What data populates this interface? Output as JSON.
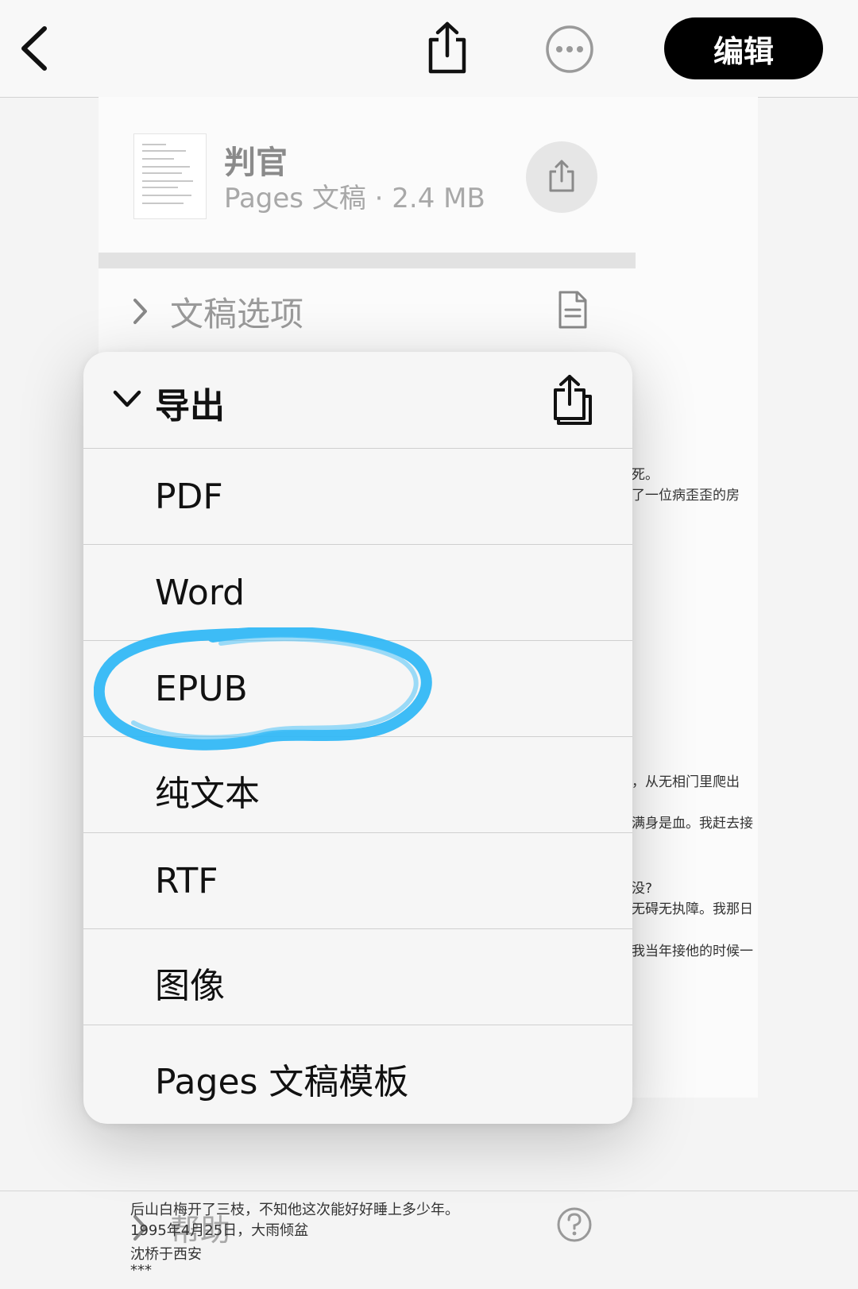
{
  "toolbar": {
    "back_icon": "chevron-left-icon",
    "share_icon": "share-icon",
    "more_icon": "ellipsis-circle-icon",
    "edit_label": "编辑"
  },
  "file": {
    "title": "判官",
    "subtitle": "Pages 文稿 · 2.4 MB",
    "share_icon": "share-icon"
  },
  "sections": {
    "document_options_label": "文稿选项",
    "document_options_icon": "document-icon",
    "help_label": "帮助",
    "help_icon": "question-circle-icon"
  },
  "export_menu": {
    "title": "导出",
    "icon": "export-copies-icon",
    "items": [
      "PDF",
      "Word",
      "EPUB",
      "纯文本",
      "RTF",
      "图像",
      "Pages 文稿模板"
    ],
    "annotation_color": "#29b6f6"
  },
  "background_text": {
    "right_fragments": [
      "死。",
      "了一位病歪歪的房",
      "，从无相门里爬出",
      "满身是血。我赶去接",
      "没?",
      "无碍无执障。我那日",
      "我当年接他的时候一"
    ],
    "bottom_lines": [
      "后山白梅开了三枝，不知他这次能好好睡上多少年。",
      "1995年4月25日，大雨倾盆",
      "沈桥于西安",
      "***"
    ]
  }
}
